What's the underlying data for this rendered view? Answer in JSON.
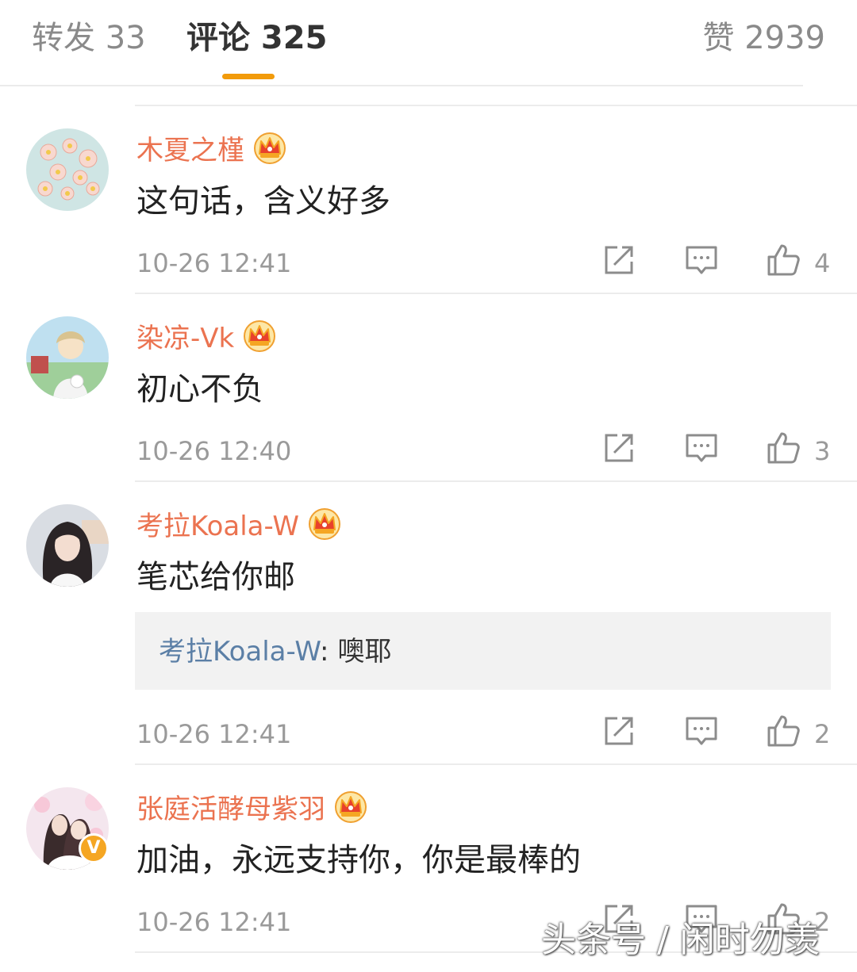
{
  "tabs": {
    "forward": "转发 33",
    "comments": "评论 325",
    "likes": "赞 2939"
  },
  "colors": {
    "accent": "#f29b0b",
    "username": "#eb7350",
    "reply_user": "#5b7fa6"
  },
  "comments": [
    {
      "username": "木夏之槿",
      "badge_icon": "crown-icon",
      "text": "这句话，含义好多",
      "time": "10-26 12:41",
      "likes": "4"
    },
    {
      "username": "染凉-Vk",
      "badge_icon": "crown-icon",
      "text": "初心不负",
      "time": "10-26 12:40",
      "likes": "3"
    },
    {
      "username": "考拉Koala-W",
      "badge_icon": "crown-icon",
      "text": "笔芯给你邮",
      "reply": {
        "user": "考拉Koala-W",
        "separator": ":",
        "text": " 噢耶"
      },
      "time": "10-26 12:41",
      "likes": "2"
    },
    {
      "username": "张庭活酵母紫羽",
      "badge_icon": "crown-icon",
      "verified": "V",
      "text": "加油，永远支持你，你是最棒的",
      "time": "10-26 12:41",
      "likes": "2"
    }
  ],
  "watermark": "头条号 / 闲时勿羡"
}
